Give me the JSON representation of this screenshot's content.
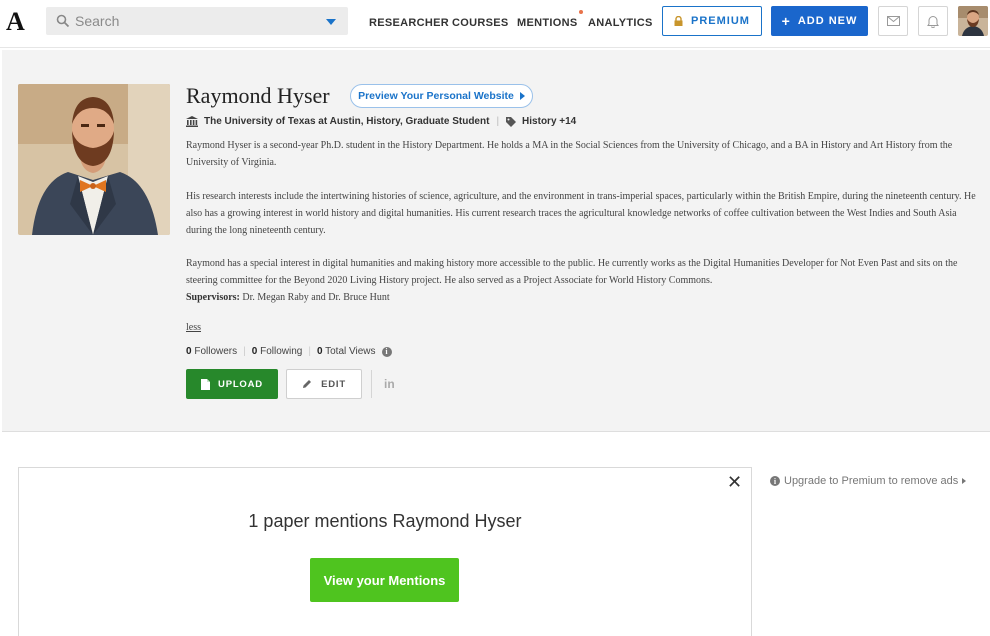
{
  "header": {
    "logo": "A",
    "search_placeholder": "Search",
    "nav": [
      "RESEARCHER",
      "COURSES",
      "MENTIONS",
      "ANALYTICS"
    ],
    "premium_label": "PREMIUM",
    "add_new_label": "ADD NEW",
    "icons": [
      "mail-icon",
      "bell-icon"
    ]
  },
  "profile": {
    "name": "Raymond Hyser",
    "preview_label": "Preview Your Personal Website",
    "affiliation": "The University of Texas at Austin, History, Graduate Student",
    "tags": "History +14",
    "bio": [
      "Raymond Hyser is a second-year Ph.D. student in the History Department. He holds a MA in the Social Sciences from the University of Chicago, and a BA in History and Art History from the University of Virginia.",
      "His research interests include the intertwining histories of science, agriculture, and the environment in trans-imperial spaces, particularly within the British Empire, during the nineteenth century. He also has a growing interest in world history and digital humanities. His current research traces the agricultural knowledge networks of coffee cultivation between the West Indies and South Asia during the long nineteenth century.",
      "Raymond has a special interest in digital humanities and making history more accessible to the public. He currently works as the Digital Humanities Developer for Not Even Past and sits on the steering committee for the Beyond 2020 Living History project. He also served as a Project Associate for World History Commons."
    ],
    "supervisors_label": "Supervisors:",
    "supervisors": "Dr. Megan Raby and Dr. Bruce Hunt",
    "less_label": "less",
    "stats": {
      "followers_count": "0",
      "followers_label": "Followers",
      "following_count": "0",
      "following_label": "Following",
      "views_count": "0",
      "views_label": "Total Views"
    },
    "upload_label": "UPLOAD",
    "edit_label": "EDIT",
    "linkedin_label": "in"
  },
  "mentions": {
    "title": "1 paper mentions Raymond Hyser",
    "button": "View your Mentions",
    "close": "✕"
  },
  "ads": {
    "upgrade_text": "Upgrade to Premium to remove ads"
  },
  "colors": {
    "primary_blue": "#1a66cc",
    "upload_green": "#27882b",
    "mentions_green": "#4fc41f",
    "profile_bg": "#f3f3f3"
  }
}
